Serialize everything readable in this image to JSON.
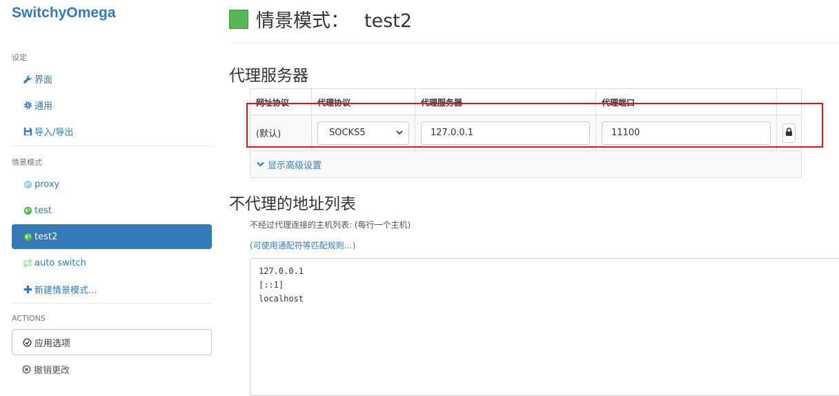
{
  "app": {
    "brand": "SwitchyOmega"
  },
  "sidebar": {
    "settings_title": "设定",
    "settings_items": [
      {
        "label": "界面",
        "icon": "wrench-icon"
      },
      {
        "label": "通用",
        "icon": "gear-icon"
      },
      {
        "label": "导入/导出",
        "icon": "floppy-icon"
      }
    ],
    "profiles_title": "情景模式",
    "profiles": [
      {
        "label": "proxy",
        "icon": "globe-icon",
        "color": "#99ccee"
      },
      {
        "label": "test",
        "icon": "globe-icon",
        "color": "#55b855"
      },
      {
        "label": "test2",
        "icon": "globe-icon",
        "color": "#55b855",
        "active": true
      },
      {
        "label": "auto switch",
        "icon": "retweet-icon",
        "color": "#99dd99"
      }
    ],
    "new_profile": "新建情景模式...",
    "actions_title": "ACTIONS",
    "apply": "应用选项",
    "discard": "撤销更改"
  },
  "header": {
    "title_prefix": "情景模式：",
    "profile_name": "test2",
    "profile_color": "#55b855"
  },
  "proxy_section": {
    "title": "代理服务器",
    "columns": [
      "网址协议",
      "代理协议",
      "代理服务器",
      "代理端口"
    ],
    "row": {
      "scheme": "(默认)",
      "protocol": "SOCKS5",
      "server": "127.0.0.1",
      "port": "11100"
    },
    "advanced": "显示高级设置"
  },
  "bypass_section": {
    "title": "不代理的地址列表",
    "help": "不经过代理连接的主机列表: (每行一个主机)",
    "wildcard_link": "(可使用通配符等匹配规则…)",
    "list": [
      "127.0.0.1",
      "[::1]",
      "localhost"
    ]
  },
  "colors": {
    "accent": "#337ab7",
    "highlight": "#e0141e"
  }
}
